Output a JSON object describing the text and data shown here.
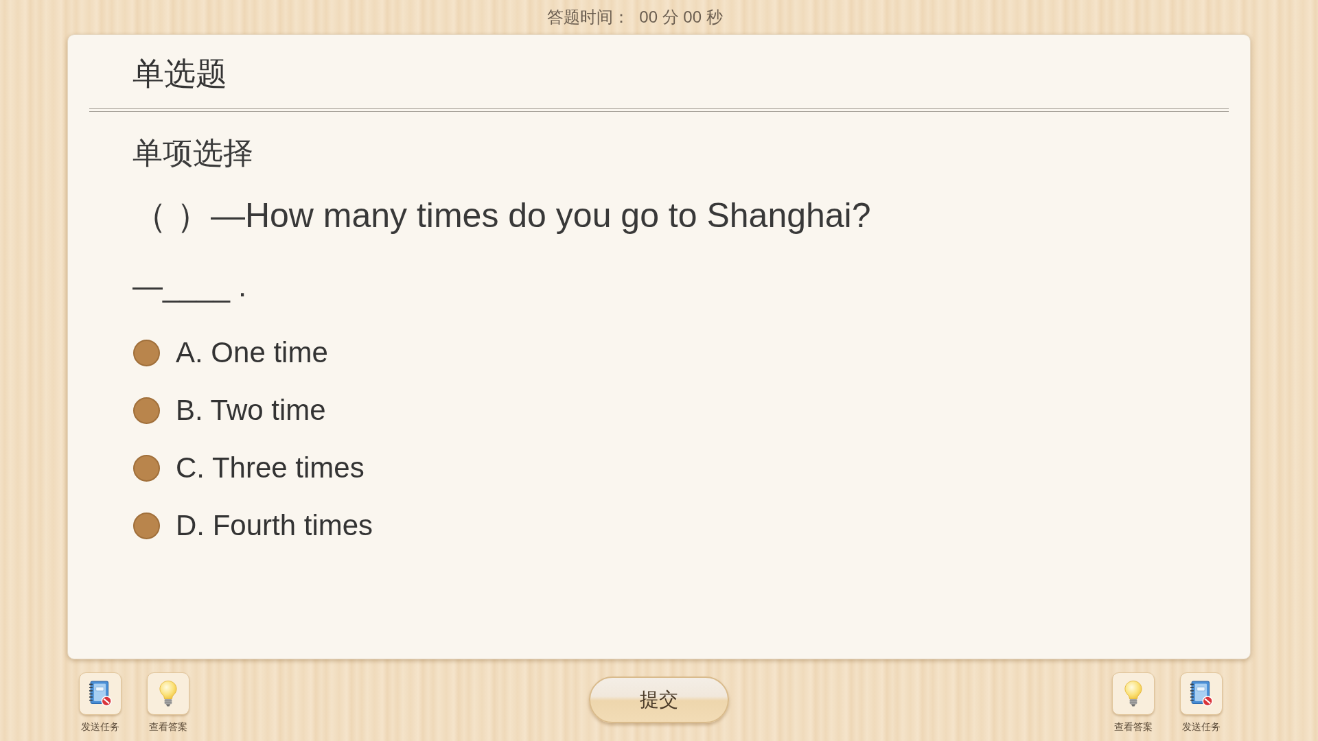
{
  "timer": {
    "label": "答题时间：",
    "value": "00 分 00 秒"
  },
  "card": {
    "title": "单选题",
    "section": "单项选择",
    "question": "（ ）—How many times do you go to Shanghai?",
    "answer_line": "—____ .",
    "options": [
      {
        "label": "A. One time",
        "selected": false
      },
      {
        "label": "B. Two time",
        "selected": false
      },
      {
        "label": "C. Three times",
        "selected": false
      },
      {
        "label": "D. Fourth times",
        "selected": false
      }
    ]
  },
  "toolbar": {
    "left": [
      {
        "kind": "send",
        "label": "发送任务"
      },
      {
        "kind": "answer",
        "label": "查看答案"
      }
    ],
    "submit": "提交",
    "right": [
      {
        "kind": "answer",
        "label": "查看答案"
      },
      {
        "kind": "send",
        "label": "发送任务"
      }
    ]
  }
}
